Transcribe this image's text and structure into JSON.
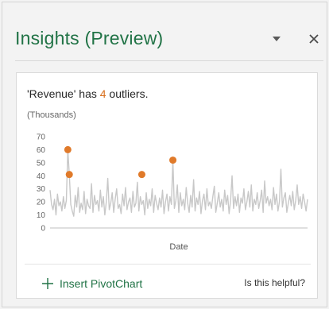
{
  "pane": {
    "title": "Insights (Preview)",
    "dropdown_icon": "caret-down-icon",
    "close_icon": "close-icon"
  },
  "card": {
    "title_prefix": "'Revenue' has ",
    "outlier_count": "4",
    "title_suffix": " outliers.",
    "subtitle": "(Thousands)",
    "insert_label": "Insert PivotChart",
    "insert_icon": "plus-icon",
    "helpful_label": "Is this helpful?"
  },
  "colors": {
    "accent_green": "#217346",
    "outlier_orange": "#e07a2a",
    "line_gray": "#c8c8c8"
  },
  "chart_data": {
    "type": "line",
    "xlabel": "Date",
    "ylabel": "",
    "ylim": [
      0,
      70
    ],
    "y_ticks": [
      0,
      10,
      20,
      30,
      40,
      50,
      60,
      70
    ],
    "grid": false,
    "values": [
      29,
      18,
      14,
      22,
      10,
      26,
      17,
      20,
      13,
      24,
      15,
      21,
      60,
      41,
      18,
      13,
      9,
      25,
      16,
      31,
      12,
      19,
      14,
      28,
      11,
      22,
      17,
      15,
      34,
      12,
      25,
      18,
      21,
      13,
      29,
      16,
      24,
      10,
      20,
      38,
      14,
      19,
      27,
      12,
      22,
      30,
      15,
      18,
      11,
      26,
      17,
      31,
      14,
      20,
      23,
      12,
      28,
      16,
      19,
      35,
      13,
      24,
      18,
      21,
      10,
      27,
      15,
      22,
      17,
      30,
      12,
      25,
      19,
      14,
      23,
      16,
      29,
      11,
      20,
      26,
      13,
      24,
      18,
      52,
      15,
      21,
      33,
      12,
      27,
      17,
      22,
      14,
      31,
      19,
      12,
      25,
      16,
      37,
      13,
      23,
      18,
      28,
      11,
      21,
      26,
      14,
      30,
      17,
      20,
      15,
      24,
      32,
      12,
      19,
      27,
      16,
      22,
      13,
      29,
      18,
      25,
      11,
      21,
      40,
      15,
      24,
      17,
      26,
      12,
      23,
      19,
      30,
      14,
      20,
      28,
      16,
      33,
      13,
      22,
      18,
      27,
      15,
      21,
      29,
      12,
      36,
      19,
      24,
      17,
      22,
      14,
      31,
      18,
      26,
      13,
      20,
      45,
      16,
      23,
      27,
      12,
      19,
      25,
      17,
      28,
      14,
      21,
      33,
      18,
      24,
      15,
      26,
      20,
      13,
      22
    ],
    "outliers": [
      {
        "index": 12,
        "value": 60
      },
      {
        "index": 13,
        "value": 41
      },
      {
        "index": 62,
        "value": 41
      },
      {
        "index": 83,
        "value": 52
      }
    ]
  }
}
